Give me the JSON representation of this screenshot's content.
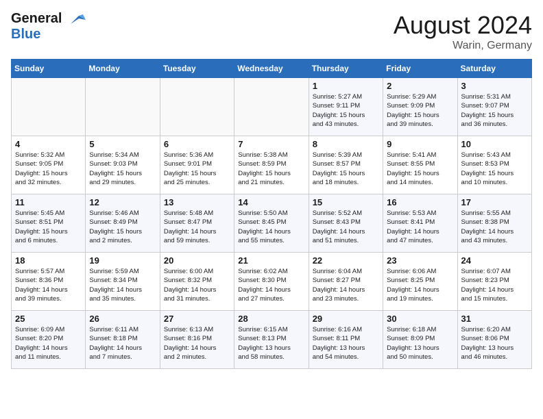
{
  "header": {
    "logo_general": "General",
    "logo_blue": "Blue",
    "month_year": "August 2024",
    "location": "Warin, Germany"
  },
  "calendar": {
    "weekdays": [
      "Sunday",
      "Monday",
      "Tuesday",
      "Wednesday",
      "Thursday",
      "Friday",
      "Saturday"
    ],
    "weeks": [
      [
        {
          "day": "",
          "info": ""
        },
        {
          "day": "",
          "info": ""
        },
        {
          "day": "",
          "info": ""
        },
        {
          "day": "",
          "info": ""
        },
        {
          "day": "1",
          "info": "Sunrise: 5:27 AM\nSunset: 9:11 PM\nDaylight: 15 hours\nand 43 minutes."
        },
        {
          "day": "2",
          "info": "Sunrise: 5:29 AM\nSunset: 9:09 PM\nDaylight: 15 hours\nand 39 minutes."
        },
        {
          "day": "3",
          "info": "Sunrise: 5:31 AM\nSunset: 9:07 PM\nDaylight: 15 hours\nand 36 minutes."
        }
      ],
      [
        {
          "day": "4",
          "info": "Sunrise: 5:32 AM\nSunset: 9:05 PM\nDaylight: 15 hours\nand 32 minutes."
        },
        {
          "day": "5",
          "info": "Sunrise: 5:34 AM\nSunset: 9:03 PM\nDaylight: 15 hours\nand 29 minutes."
        },
        {
          "day": "6",
          "info": "Sunrise: 5:36 AM\nSunset: 9:01 PM\nDaylight: 15 hours\nand 25 minutes."
        },
        {
          "day": "7",
          "info": "Sunrise: 5:38 AM\nSunset: 8:59 PM\nDaylight: 15 hours\nand 21 minutes."
        },
        {
          "day": "8",
          "info": "Sunrise: 5:39 AM\nSunset: 8:57 PM\nDaylight: 15 hours\nand 18 minutes."
        },
        {
          "day": "9",
          "info": "Sunrise: 5:41 AM\nSunset: 8:55 PM\nDaylight: 15 hours\nand 14 minutes."
        },
        {
          "day": "10",
          "info": "Sunrise: 5:43 AM\nSunset: 8:53 PM\nDaylight: 15 hours\nand 10 minutes."
        }
      ],
      [
        {
          "day": "11",
          "info": "Sunrise: 5:45 AM\nSunset: 8:51 PM\nDaylight: 15 hours\nand 6 minutes."
        },
        {
          "day": "12",
          "info": "Sunrise: 5:46 AM\nSunset: 8:49 PM\nDaylight: 15 hours\nand 2 minutes."
        },
        {
          "day": "13",
          "info": "Sunrise: 5:48 AM\nSunset: 8:47 PM\nDaylight: 14 hours\nand 59 minutes."
        },
        {
          "day": "14",
          "info": "Sunrise: 5:50 AM\nSunset: 8:45 PM\nDaylight: 14 hours\nand 55 minutes."
        },
        {
          "day": "15",
          "info": "Sunrise: 5:52 AM\nSunset: 8:43 PM\nDaylight: 14 hours\nand 51 minutes."
        },
        {
          "day": "16",
          "info": "Sunrise: 5:53 AM\nSunset: 8:41 PM\nDaylight: 14 hours\nand 47 minutes."
        },
        {
          "day": "17",
          "info": "Sunrise: 5:55 AM\nSunset: 8:38 PM\nDaylight: 14 hours\nand 43 minutes."
        }
      ],
      [
        {
          "day": "18",
          "info": "Sunrise: 5:57 AM\nSunset: 8:36 PM\nDaylight: 14 hours\nand 39 minutes."
        },
        {
          "day": "19",
          "info": "Sunrise: 5:59 AM\nSunset: 8:34 PM\nDaylight: 14 hours\nand 35 minutes."
        },
        {
          "day": "20",
          "info": "Sunrise: 6:00 AM\nSunset: 8:32 PM\nDaylight: 14 hours\nand 31 minutes."
        },
        {
          "day": "21",
          "info": "Sunrise: 6:02 AM\nSunset: 8:30 PM\nDaylight: 14 hours\nand 27 minutes."
        },
        {
          "day": "22",
          "info": "Sunrise: 6:04 AM\nSunset: 8:27 PM\nDaylight: 14 hours\nand 23 minutes."
        },
        {
          "day": "23",
          "info": "Sunrise: 6:06 AM\nSunset: 8:25 PM\nDaylight: 14 hours\nand 19 minutes."
        },
        {
          "day": "24",
          "info": "Sunrise: 6:07 AM\nSunset: 8:23 PM\nDaylight: 14 hours\nand 15 minutes."
        }
      ],
      [
        {
          "day": "25",
          "info": "Sunrise: 6:09 AM\nSunset: 8:20 PM\nDaylight: 14 hours\nand 11 minutes."
        },
        {
          "day": "26",
          "info": "Sunrise: 6:11 AM\nSunset: 8:18 PM\nDaylight: 14 hours\nand 7 minutes."
        },
        {
          "day": "27",
          "info": "Sunrise: 6:13 AM\nSunset: 8:16 PM\nDaylight: 14 hours\nand 2 minutes."
        },
        {
          "day": "28",
          "info": "Sunrise: 6:15 AM\nSunset: 8:13 PM\nDaylight: 13 hours\nand 58 minutes."
        },
        {
          "day": "29",
          "info": "Sunrise: 6:16 AM\nSunset: 8:11 PM\nDaylight: 13 hours\nand 54 minutes."
        },
        {
          "day": "30",
          "info": "Sunrise: 6:18 AM\nSunset: 8:09 PM\nDaylight: 13 hours\nand 50 minutes."
        },
        {
          "day": "31",
          "info": "Sunrise: 6:20 AM\nSunset: 8:06 PM\nDaylight: 13 hours\nand 46 minutes."
        }
      ]
    ]
  }
}
